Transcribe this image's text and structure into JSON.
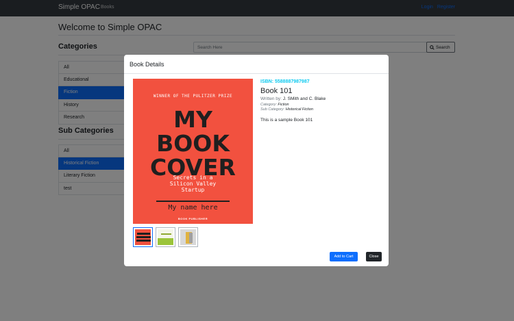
{
  "navbar": {
    "brand": "Simple OPAC",
    "books_link": "Books",
    "login": "Login",
    "register": "Register"
  },
  "page": {
    "title": "Welcome to Simple OPAC"
  },
  "categories": {
    "heading": "Categories",
    "items": [
      "All",
      "Educational",
      "Fiction",
      "History",
      "Research"
    ],
    "active": "Fiction"
  },
  "sub_categories": {
    "heading": "Sub Categories",
    "items": [
      "All",
      "Historical Fiction",
      "Literary Fiction",
      "test"
    ],
    "active": "Historical Fiction"
  },
  "search": {
    "placeholder": "Search Here",
    "button_label": "Search"
  },
  "modal": {
    "title": "Book Details",
    "cover": {
      "award": "WINNER OF THE PULITZER PRIZE",
      "line1": "MY",
      "line2": "BOOK",
      "line3": "COVER",
      "subtitle_1": "Secrets in a",
      "subtitle_2": "Silicon Valley",
      "subtitle_3": "Startup",
      "author_name": "My name here",
      "publisher": "BOOK PUBLISHER"
    },
    "isbn": "ISBN: 5588887987987",
    "book_title": "Book 101",
    "written_by_label": "Written by:",
    "authors": "J. SMith and C. Blake",
    "category_label": "Category:",
    "category": "Fiction",
    "sub_category_label": "Sub Category:",
    "sub_category": "Historical Fiction",
    "description": "This is a sample Book 101",
    "add_to_cart": "Add to Cart",
    "close": "Close"
  },
  "colors": {
    "navbar": "#343a40",
    "primary": "#0d6efd",
    "cover": "#f2513f",
    "isbn": "#0dcaf0",
    "dark_button": "#212529"
  }
}
